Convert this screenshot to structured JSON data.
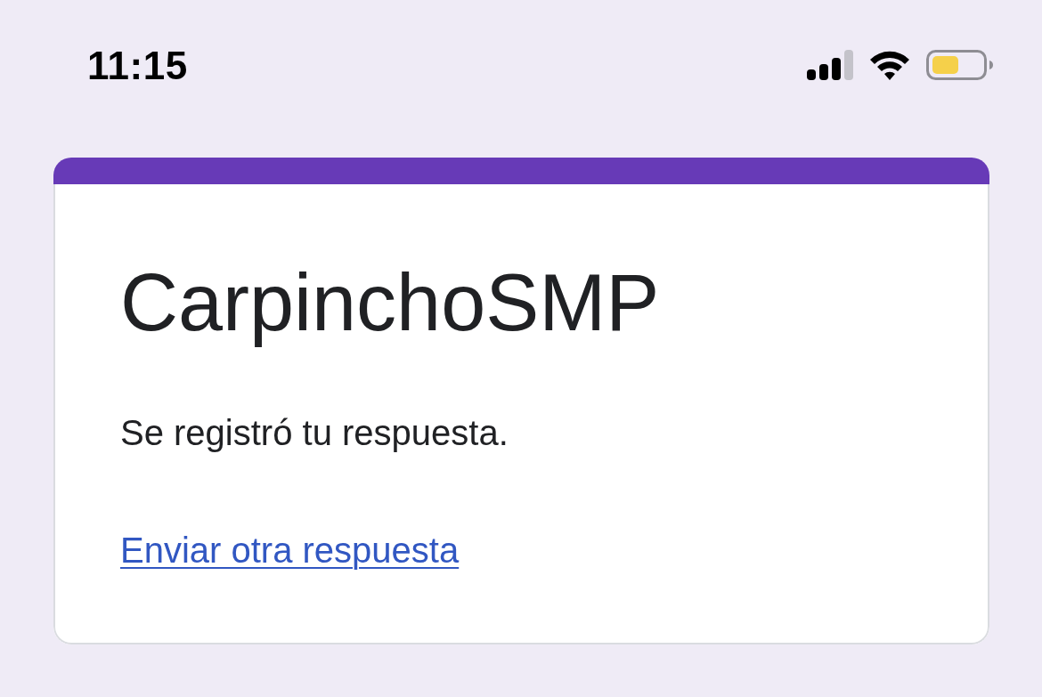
{
  "status_bar": {
    "time": "11:15"
  },
  "form_card": {
    "title": "CarpinchoSMP",
    "message": "Se registró tu respuesta.",
    "link": "Enviar otra respuesta"
  }
}
